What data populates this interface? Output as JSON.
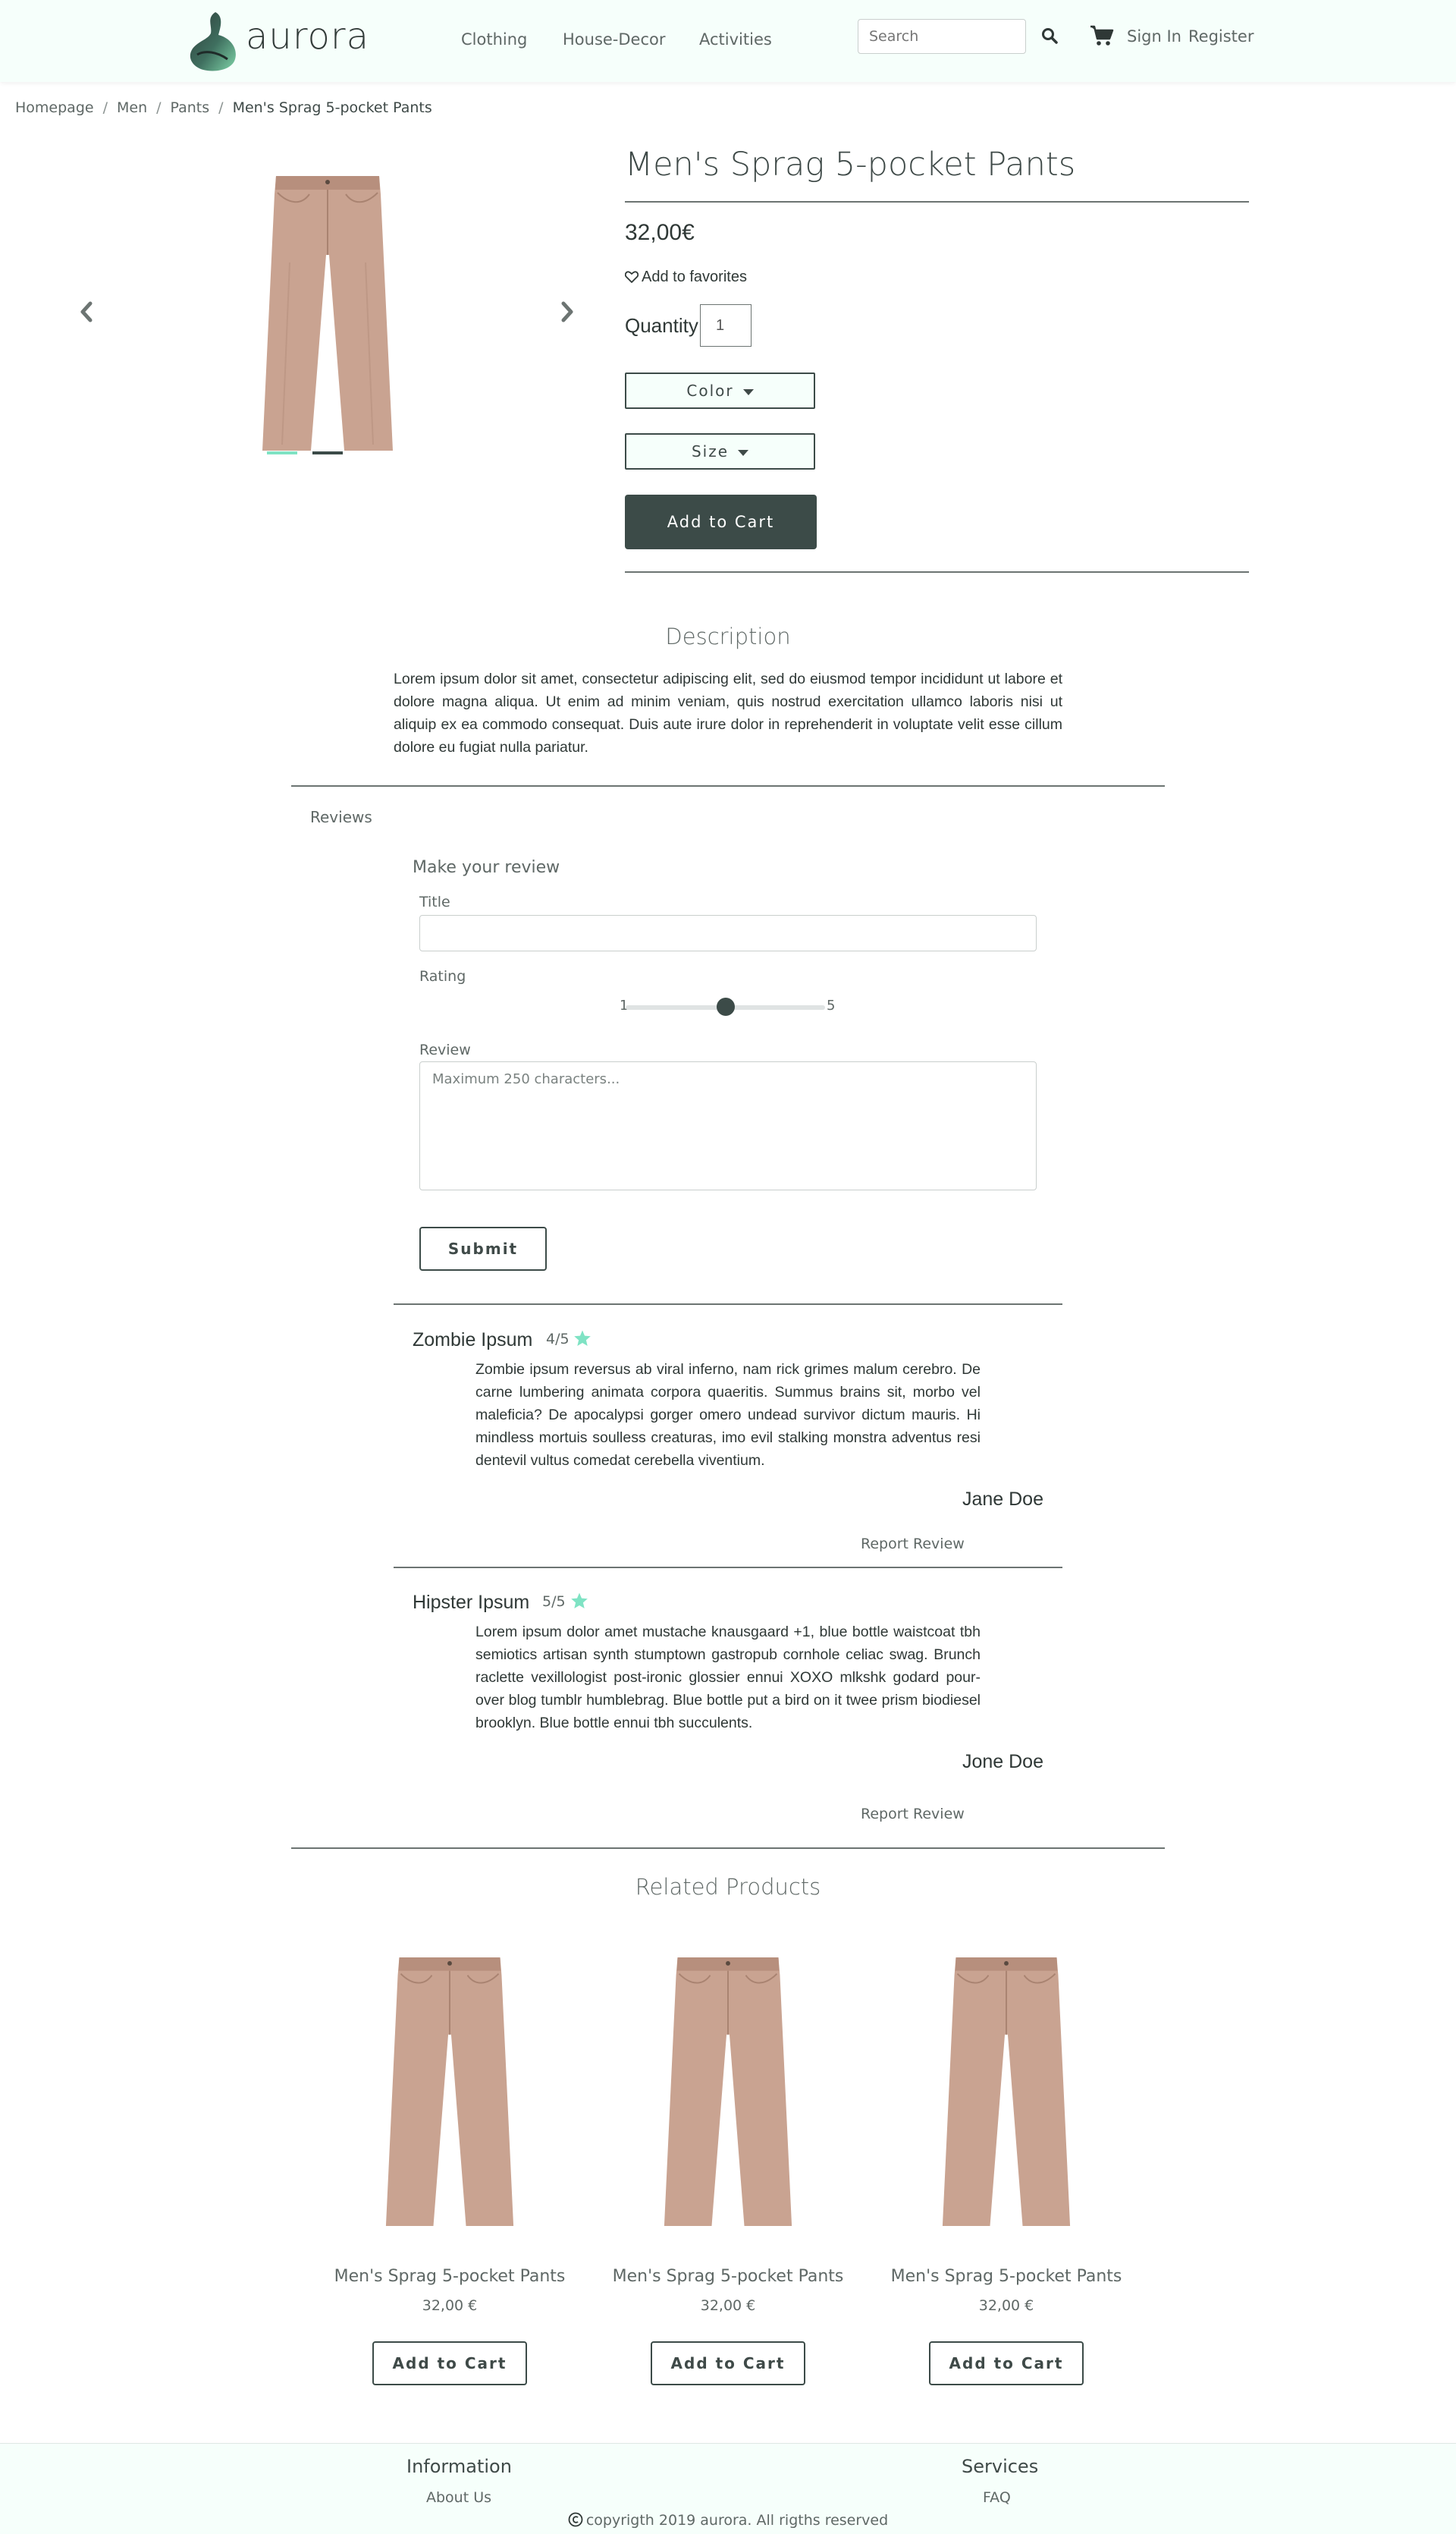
{
  "navbar": {
    "brand": "aurora",
    "links": [
      "Clothing",
      "House-Decor",
      "Activities"
    ],
    "search_placeholder": "Search",
    "sign_in": "Sign In",
    "register": "Register"
  },
  "breadcrumb": [
    "Homepage",
    "Men",
    "Pants",
    "Men's Sprag 5-pocket Pants"
  ],
  "product": {
    "title": "Men's Sprag 5-pocket Pants",
    "price": "32,00€",
    "favorites_label": "Add to favorites",
    "quantity_label": "Quantity",
    "quantity_value": "1",
    "color_label": "Color",
    "size_label": "Size",
    "add_to_cart": "Add to Cart",
    "carousel_active_index": 0,
    "carousel_slides": 2
  },
  "description": {
    "title": "Description",
    "text": "Lorem ipsum dolor sit amet, consectetur adipiscing elit, sed do eiusmod tempor incididunt ut labore et dolore magna aliqua. Ut enim ad minim veniam, quis nostrud exercitation ullamco laboris nisi ut aliquip ex ea commodo consequat. Duis aute irure dolor in reprehenderit in voluptate velit esse cillum dolore eu fugiat nulla pariatur."
  },
  "reviews": {
    "tab_label": "Reviews",
    "form": {
      "heading": "Make your review",
      "title_label": "Title",
      "rating_label": "Rating",
      "rating_min": "1",
      "rating_max": "5",
      "rating_value": 3,
      "review_label": "Review",
      "review_placeholder": "Maximum 250 characters...",
      "submit": "Submit"
    },
    "items": [
      {
        "title": "Zombie Ipsum",
        "score": "4/5",
        "body": "Zombie ipsum reversus ab viral inferno, nam rick grimes malum cerebro. De carne lumbering animata corpora quaeritis. Summus brains sit, morbo vel maleficia? De apocalypsi gorger omero undead survivor dictum mauris. Hi mindless mortuis soulless creaturas, imo evil stalking monstra adventus resi dentevil vultus comedat cerebella viventium.",
        "author": "Jane Doe",
        "report": "Report Review"
      },
      {
        "title": "Hipster Ipsum",
        "score": "5/5",
        "body": "Lorem ipsum dolor amet mustache knausgaard +1, blue bottle waistcoat tbh semiotics artisan synth stumptown gastropub cornhole celiac swag. Brunch raclette vexillologist post-ironic glossier ennui XOXO mlkshk godard pour-over blog tumblr humblebrag. Blue bottle put a bird on it twee prism biodiesel brooklyn. Blue bottle ennui tbh succulents.",
        "author": "Jone Doe",
        "report": "Report Review"
      }
    ]
  },
  "related": {
    "title": "Related Products",
    "items": [
      {
        "name": "Men's Sprag 5-pocket Pants",
        "price": "32,00 €",
        "button": "Add to Cart"
      },
      {
        "name": "Men's Sprag 5-pocket Pants",
        "price": "32,00 €",
        "button": "Add to Cart"
      },
      {
        "name": "Men's Sprag 5-pocket Pants",
        "price": "32,00 €",
        "button": "Add to Cart"
      }
    ]
  },
  "footer": {
    "information_title": "Information",
    "information_link": "About Us",
    "services_title": "Services",
    "services_link": "FAQ",
    "copyright": "copyrigth 2019 aurora. All rigths reserved"
  },
  "colors": {
    "brand_dark": "#3c4b48",
    "accent_mint": "#7fe3c4",
    "nav_bg": "#f6fffb"
  },
  "icons": [
    "logo",
    "search-icon",
    "cart-icon",
    "heart-icon",
    "chevron-left-icon",
    "chevron-right-icon",
    "star-icon",
    "copyright-icon"
  ]
}
